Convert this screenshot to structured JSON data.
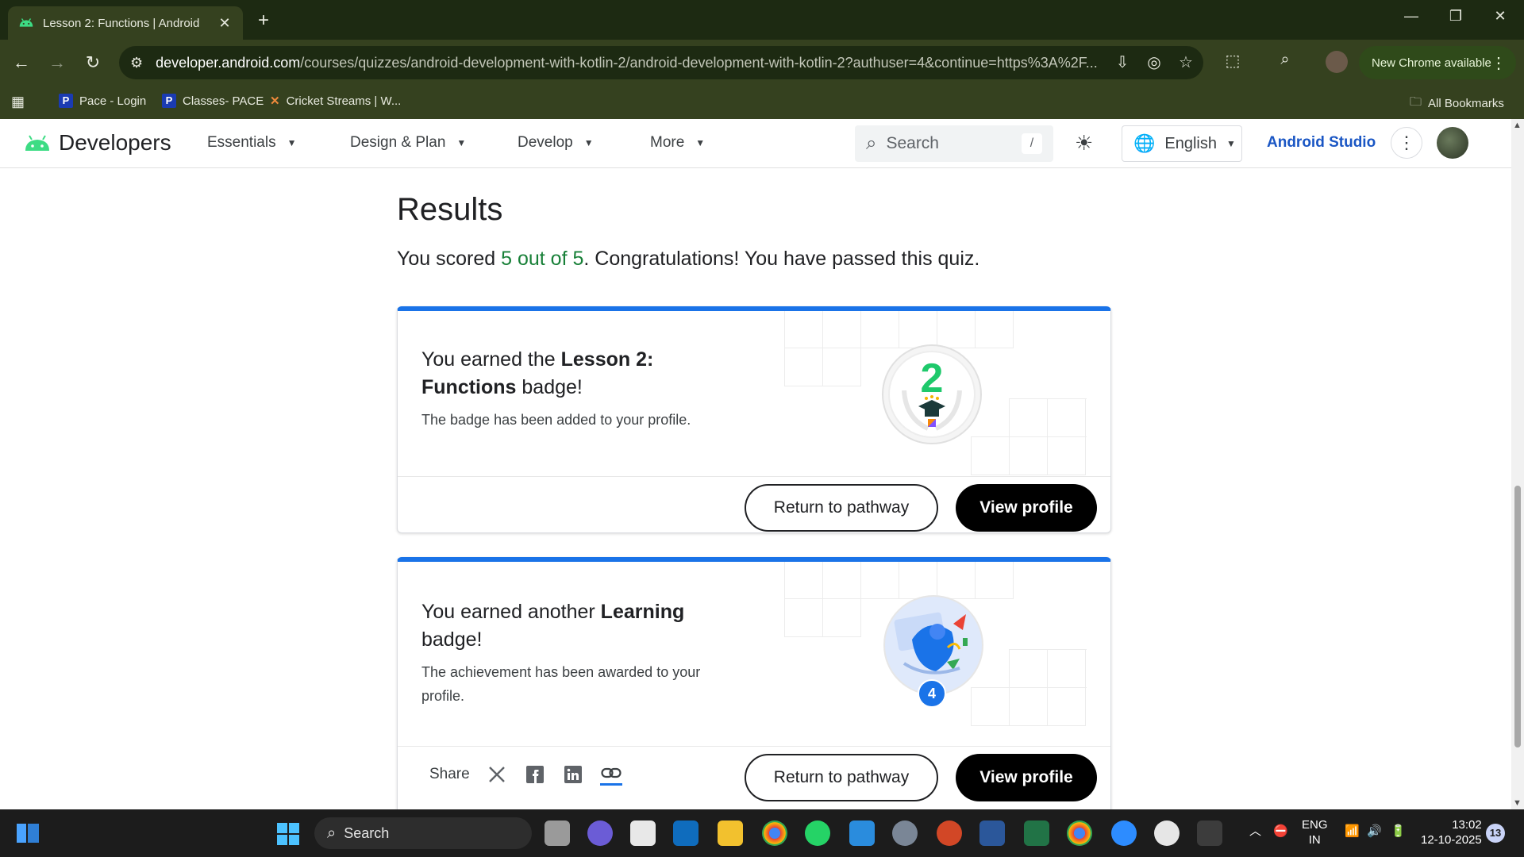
{
  "browser": {
    "tab_title": "Lesson 2: Functions  |  Android",
    "url_host": "developer.android.com",
    "url_path": "/courses/quizzes/android-development-with-kotlin-2/android-development-with-kotlin-2?authuser=4&continue=https%3A%2F...",
    "new_chrome_label": "New Chrome available",
    "bookmarks": [
      "Pace - Login",
      "Classes- PACE",
      "Cricket Streams | W..."
    ],
    "all_bookmarks": "All Bookmarks"
  },
  "site_header": {
    "logo_text": "Developers",
    "menu": [
      "Essentials",
      "Design & Plan",
      "Develop",
      "More"
    ],
    "search_placeholder": "Search",
    "search_shortcut": "/",
    "language": "English",
    "studio_link": "Android Studio"
  },
  "results": {
    "title": "Results",
    "score_prefix": "You scored ",
    "score_value": "5 out of 5",
    "score_suffix": ". Congratulations! You have passed this quiz."
  },
  "cards": [
    {
      "heading_prefix": "You earned the ",
      "heading_bold": "Lesson 2: Functions",
      "heading_suffix": " badge!",
      "description": "The badge has been added to your profile.",
      "badge_number": "2",
      "return_label": "Return to pathway",
      "view_label": "View profile"
    },
    {
      "heading_prefix": "You earned another ",
      "heading_bold": "Learning",
      "heading_suffix": " badge!",
      "description": "The achievement has been awarded to your profile.",
      "badge_count": "4",
      "share_label": "Share",
      "return_label": "Return to pathway",
      "view_label": "View profile"
    }
  ],
  "taskbar": {
    "search_label": "Search",
    "lang_top": "ENG",
    "lang_bottom": "IN",
    "time": "13:02",
    "date": "12-10-2025",
    "notifications": "13"
  },
  "colors": {
    "accent_blue": "#1a73e8",
    "success_green": "#188038",
    "chrome_frame": "#35411f"
  }
}
